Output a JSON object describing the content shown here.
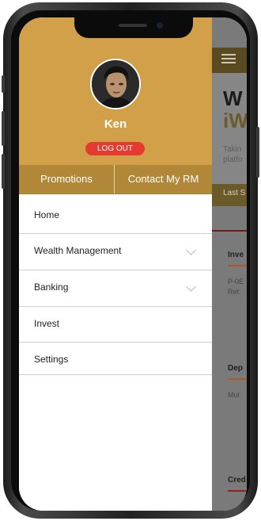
{
  "profile": {
    "name": "Ken",
    "logout_label": "LOG OUT"
  },
  "tabs": {
    "promotions": "Promotions",
    "contact_rm": "Contact My RM"
  },
  "menu": {
    "items": [
      {
        "label": "Home"
      },
      {
        "label": "Wealth Management"
      },
      {
        "label": "Banking"
      },
      {
        "label": "Invest"
      },
      {
        "label": "Settings"
      }
    ]
  },
  "background_app": {
    "title_line1": "W",
    "title_line2": "iW",
    "subtitle_line1": "Takin",
    "subtitle_line2": "platfo",
    "bar_text": "Last S",
    "section1_title": "Inve",
    "section1_note1": "P-0E",
    "section1_note2": "Ref.",
    "section2_title": "Dep",
    "section2_note": "Mul",
    "section3_title": "Cred"
  },
  "colors": {
    "profile_bg": "#d3a04a",
    "tabs_bg": "#b08838",
    "logout_bg": "#e43a2f"
  }
}
